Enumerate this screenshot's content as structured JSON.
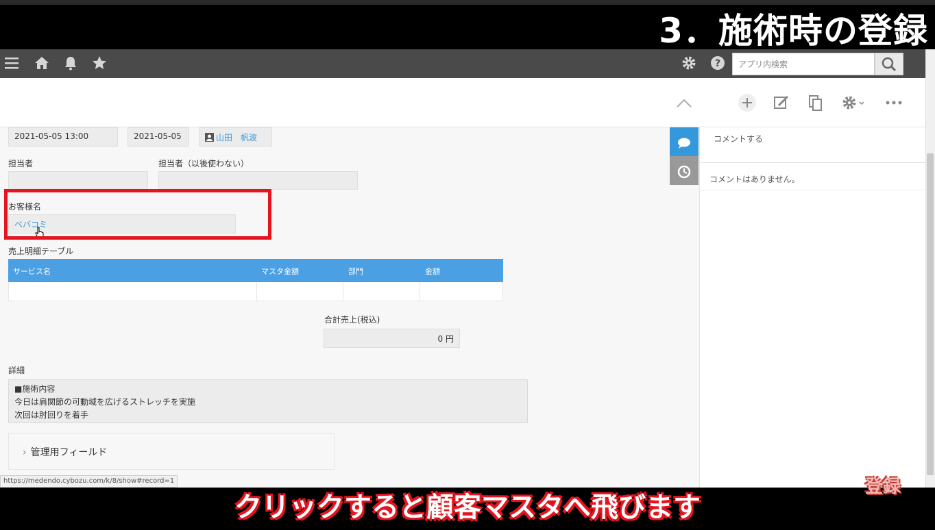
{
  "overlay": {
    "title": "3．施術時の登録",
    "subtitle": "クリックすると顧客マスタへ飛びます",
    "stamp": "登録"
  },
  "header": {
    "search_placeholder": "アプリ内検索",
    "icons": [
      "menu-icon",
      "home-icon",
      "bell-icon",
      "star-icon",
      "gear-icon",
      "help-icon",
      "search-icon"
    ]
  },
  "toolbar": {
    "icons": [
      "chevron-up-icon",
      "add-icon",
      "edit-icon",
      "copy-icon",
      "settings-icon",
      "more-icon"
    ]
  },
  "record": {
    "datetime": "2021-05-05 13:00",
    "date": "2021-05-05",
    "user": "山田　帆波",
    "staff_label": "担当者",
    "staff_value": "",
    "staff_old_label": "担当者（以後使わない）",
    "staff_old_value": "",
    "customer_label": "お客様名",
    "customer_value": "ベバコミ",
    "sales_table_label": "売上明細テーブル",
    "table_columns": [
      "サービス名",
      "マスタ金額",
      "部門",
      "金額"
    ],
    "total_label": "合計売上(税込)",
    "total_value": "0 円",
    "detail_label": "詳細",
    "detail_lines": [
      "■施術内容",
      "今日は肩関節の可動域を広げるストレッチを実施",
      "次回は肘回りを着手"
    ],
    "admin_field": "管理用フィールド"
  },
  "comments": {
    "placeholder": "コメントする",
    "empty": "コメントはありません。"
  },
  "status_url": "https://medendo.cybozu.com/k/8/show#record=1",
  "colors": {
    "accent": "#4aa0e3",
    "highlight": "#e5141e",
    "header_bg": "#4a4a4a"
  }
}
